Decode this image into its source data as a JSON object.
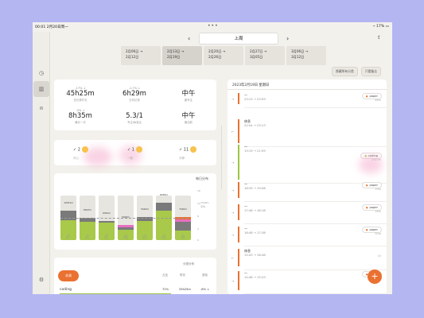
{
  "status": {
    "time": "00:01",
    "date": "2月20日周一",
    "battery": "17%"
  },
  "topbar": {
    "period": "上周",
    "prev": "‹",
    "next": "›",
    "weeks": [
      {
        "l1": "2月06日 →",
        "l2": "2月12日"
      },
      {
        "l1": "2月13日 →",
        "l2": "2月19日"
      },
      {
        "l1": "2月20日 →",
        "l2": "2月26日"
      },
      {
        "l1": "2月27日 →",
        "l2": "3月05日"
      },
      {
        "l1": "3月06日 →",
        "l2": "3月12日"
      }
    ]
  },
  "chips": [
    "隐藏所有分类",
    "只看备忘"
  ],
  "stats": [
    {
      "delta": "-17% ↓",
      "value": "45h25m",
      "label": "总记录时长"
    },
    {
      "delta": "-1.7% ↓",
      "value": "6h29m",
      "label": "日均记录"
    },
    {
      "delta": "",
      "value": "中午",
      "label": "最专注"
    },
    {
      "delta": "-5% ↓",
      "value": "8h35m",
      "label": "最长一天"
    },
    {
      "delta": "",
      "value": "5.3/1",
      "label": "专注/休息比"
    },
    {
      "delta": "",
      "value": "中午",
      "label": "最活跃"
    }
  ],
  "moods": [
    {
      "count": "2",
      "label": "开心"
    },
    {
      "count": "1",
      "label": "一般"
    },
    {
      "count": "11",
      "label": "平静"
    }
  ],
  "chart": {
    "title": "每日分布",
    "y_ticks": [
      "16",
      "12",
      "8",
      "4",
      "0"
    ],
    "right_label": "7h28m",
    "right_label2": "平均"
  },
  "chart_data": {
    "type": "bar",
    "title": "每日分布",
    "categories": [
      "周一",
      "周二",
      "周三",
      "周四",
      "周五",
      "周六",
      "周日"
    ],
    "x_sub": [
      "13",
      "14",
      "15",
      "16",
      "17",
      "18",
      "19"
    ],
    "totals": [
      "10h31m",
      "8h07m",
      "6h52m",
      "5h03m",
      "5h44m",
      "8h35m",
      "7h20m"
    ],
    "series": [
      {
        "name": "",
        "values": [
          7.2,
          6.5,
          6.4,
          3.8,
          6.8,
          10.6,
          3.5
        ]
      },
      {
        "name": "",
        "values": [
          3.3,
          1.6,
          0.4,
          0.8,
          1.5,
          2.8,
          3.0
        ]
      },
      {
        "name": "",
        "values": [
          0,
          0,
          0,
          0.9,
          0,
          0,
          0.9
        ]
      },
      {
        "name": "",
        "values": [
          0,
          0,
          0,
          0,
          0,
          0,
          0.8
        ]
      }
    ],
    "ylim": [
      0,
      16
    ]
  },
  "categories_card": {
    "title": "分类分布",
    "cols": [
      "分类",
      "占比",
      "时长",
      "变化"
    ],
    "row": {
      "name": "coding",
      "pct": "72%",
      "dur": "33h25m",
      "chg": "-8% ↓"
    }
  },
  "fab_left": "本周",
  "right": {
    "date": "2023年2月19日 星期日",
    "entries": [
      {
        "arrow": "→",
        "title": "—",
        "time": "23:13 → 23:59",
        "tag": "paper",
        "dur": "46m",
        "green": false
      },
      {
        "arrow": "←",
        "title": "休息",
        "time": "22:04 → 23:13",
        "tag": "",
        "dur": "",
        "green": false
      },
      {
        "arrow": "→",
        "title": "—",
        "time": "19:19 → 21:59",
        "tag": "coding",
        "dur": "2h40m",
        "green": true
      },
      {
        "arrow": "→",
        "title": "—",
        "time": "18:39 → 19:08",
        "tag": "paper",
        "dur": "29m",
        "green": false
      },
      {
        "arrow": "→",
        "title": "—",
        "time": "17:48 → 18:16",
        "tag": "paper",
        "dur": "28m",
        "green": false
      },
      {
        "arrow": "→",
        "title": "—",
        "time": "16:48 → 17:38",
        "tag": "paper",
        "dur": "50m",
        "green": false
      },
      {
        "arrow": "←",
        "title": "休息",
        "time": "15:43 → 16:48",
        "tag": "",
        "dur": "1h",
        "green": false
      },
      {
        "arrow": "→",
        "title": "—",
        "time": "14:48 → 15:43",
        "tag": "paper",
        "dur": "55m",
        "green": false
      }
    ]
  },
  "fab_right": "+"
}
